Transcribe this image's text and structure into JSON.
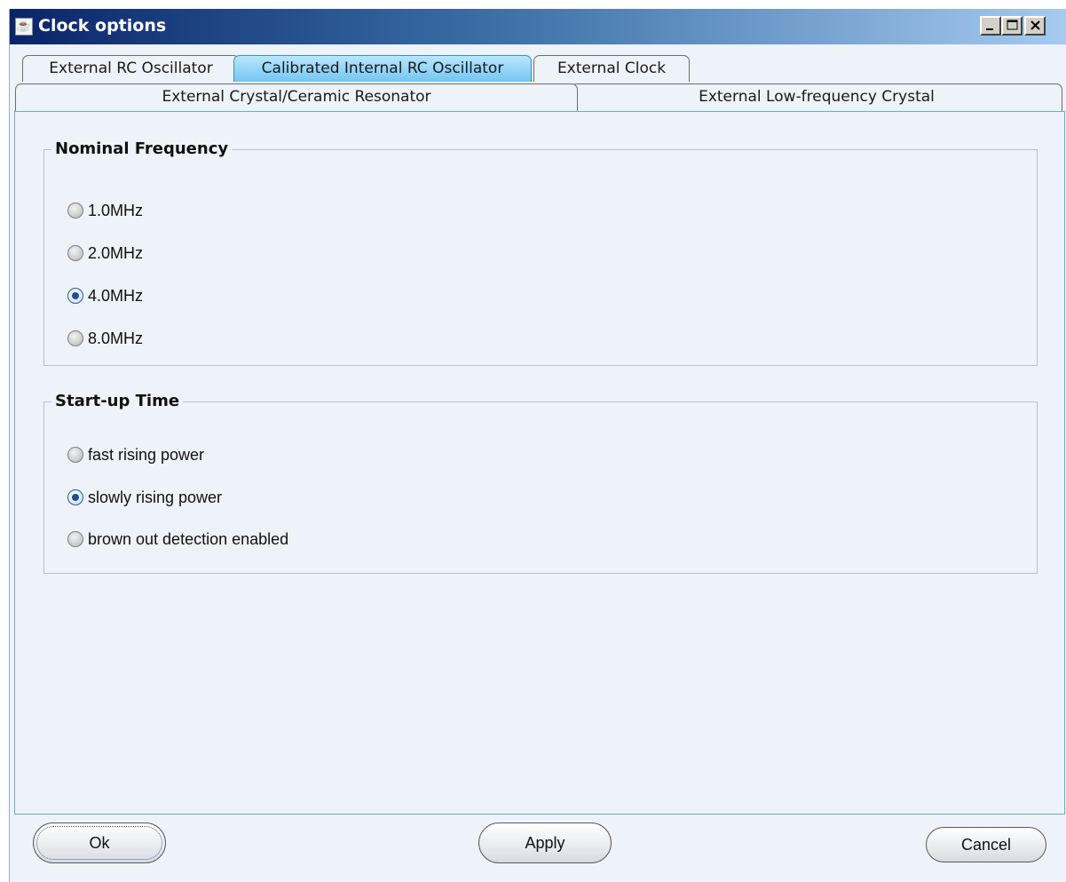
{
  "window": {
    "title": "Clock options",
    "icon": "java-cup-icon"
  },
  "tabs": {
    "row1": [
      {
        "label": "External RC Oscillator",
        "active": false
      },
      {
        "label": "Calibrated Internal RC Oscillator",
        "active": true
      },
      {
        "label": "External Clock",
        "active": false
      }
    ],
    "row2": [
      {
        "label": "External Crystal/Ceramic Resonator",
        "active": false
      },
      {
        "label": "External Low-frequency Crystal",
        "active": false
      }
    ]
  },
  "nominal_frequency": {
    "legend": "Nominal Frequency",
    "options": [
      "1.0MHz",
      "2.0MHz",
      "4.0MHz",
      "8.0MHz"
    ],
    "selected": "4.0MHz"
  },
  "startup_time": {
    "legend": "Start-up Time",
    "options": [
      "fast rising power",
      "slowly rising power",
      "brown out detection enabled"
    ],
    "selected": "slowly rising power"
  },
  "buttons": {
    "ok": "Ok",
    "apply": "Apply",
    "cancel": "Cancel"
  },
  "colors": {
    "active_tab": "#74c6f2",
    "panel_border": "#5eb1d8",
    "title_bar_start": "#0a246a"
  }
}
